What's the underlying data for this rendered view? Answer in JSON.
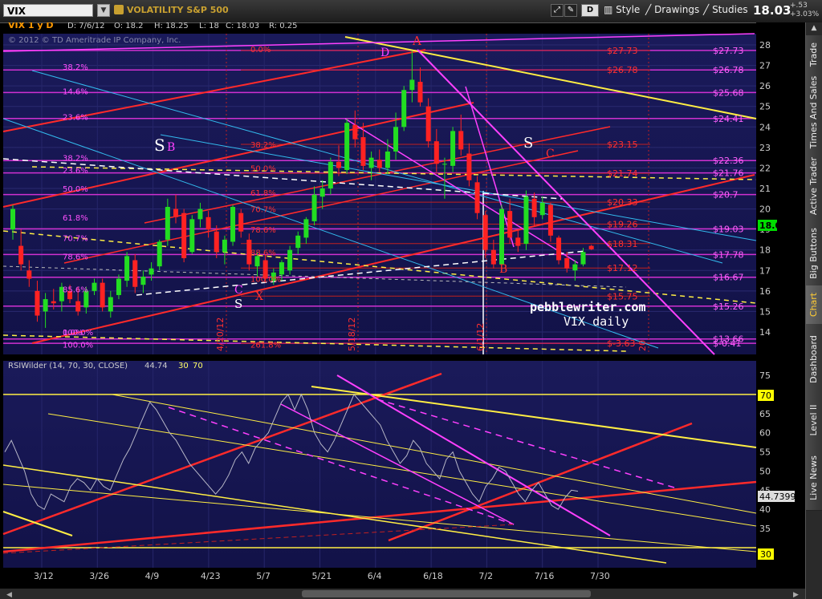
{
  "toolbar": {
    "symbol": "VIX",
    "symbol_name": "VOLATILITY S&P 500",
    "period_button": "D",
    "style_label": "Style",
    "drawings_label": "Drawings",
    "studies_label": "Studies",
    "last_price": "18.03",
    "net_change": "+.53",
    "pct_change": "+3.03%"
  },
  "sidebar": {
    "tabs": [
      {
        "label": "Trade",
        "active": false
      },
      {
        "label": "Times And Sales",
        "active": false
      },
      {
        "label": "Active Trader",
        "active": false
      },
      {
        "label": "Big Buttons",
        "active": false
      },
      {
        "label": "Chart",
        "active": true
      },
      {
        "label": "Dashboard",
        "active": false
      },
      {
        "label": "Level II",
        "active": false
      },
      {
        "label": "Live News",
        "active": false
      }
    ]
  },
  "price_chart": {
    "symbol_label": "VIX 1 y D",
    "ohlc": {
      "date": "D: 7/6/12",
      "open": "O: 18.2",
      "high": "H: 18.25",
      "low": "L: 18",
      "close": "C: 18.03",
      "range": "R: 0.25"
    },
    "copyright": "© 2012 © TD Ameritrade IP Company, Inc.",
    "watermark_1": "pebblewriter.com",
    "watermark_2": "VIX daily",
    "current_price_tag": "18.03",
    "price_axis_ticks": [
      "28",
      "27",
      "26",
      "25",
      "24",
      "23",
      "22",
      "21",
      "20",
      "19",
      "18",
      "17",
      "16",
      "15",
      "14"
    ],
    "right_level_labels": [
      {
        "text": "$27.73",
        "value": 27.73
      },
      {
        "text": "$26.78",
        "value": 26.78
      },
      {
        "text": "$25.68",
        "value": 25.68
      },
      {
        "text": "$24.41",
        "value": 24.41
      },
      {
        "text": "$22.36",
        "value": 22.36
      },
      {
        "text": "$21.76",
        "value": 21.76
      },
      {
        "text": "$20.7",
        "value": 20.7
      },
      {
        "text": "$19.03",
        "value": 19.03
      },
      {
        "text": "$17.78",
        "value": 17.78
      },
      {
        "text": "$16.67",
        "value": 16.67
      },
      {
        "text": "$15.26",
        "value": 15.26
      },
      {
        "text": "$13.66",
        "value": 13.66
      },
      {
        "text": "$-0.41",
        "value": 13.45
      }
    ],
    "mid_level_labels": [
      {
        "text": "$27.73",
        "value": 27.73
      },
      {
        "text": "$26.78",
        "value": 26.78
      },
      {
        "text": "$23.15",
        "value": 23.15
      },
      {
        "text": "$21.74",
        "value": 21.74
      },
      {
        "text": "$20.33",
        "value": 20.33
      },
      {
        "text": "$19.26",
        "value": 19.26
      },
      {
        "text": "$18.31",
        "value": 18.31
      },
      {
        "text": "$17.12",
        "value": 17.12
      },
      {
        "text": "$15.75",
        "value": 15.75
      },
      {
        "text": "$-3.63",
        "value": 13.45
      }
    ],
    "fib_left_labels": [
      {
        "text": "38.2%",
        "value": 26.95
      },
      {
        "text": "14.6%",
        "value": 25.75
      },
      {
        "text": "23.6%",
        "value": 24.5
      },
      {
        "text": "38.2%",
        "value": 22.5
      },
      {
        "text": "23.6%",
        "value": 21.9
      },
      {
        "text": "50.0%",
        "value": 21.0
      },
      {
        "text": "61.8%",
        "value": 19.6
      },
      {
        "text": "70.7%",
        "value": 18.6
      },
      {
        "text": "78.6%",
        "value": 17.7
      },
      {
        "text": "85.6%",
        "value": 16.1
      },
      {
        "text": "100.0%",
        "value": 14.0
      },
      {
        "text": "0.0%",
        "value": 14.0
      },
      {
        "text": "100.0%",
        "value": 13.4
      }
    ],
    "fib_mid_labels": [
      {
        "text": "0.0%",
        "value": 27.8
      },
      {
        "text": "38.2%",
        "value": 23.15
      },
      {
        "text": "50.0%",
        "value": 22.0
      },
      {
        "text": "61.8%",
        "value": 20.8
      },
      {
        "text": "70.7%",
        "value": 20.0
      },
      {
        "text": "78.6%",
        "value": 19.0
      },
      {
        "text": "88.6%",
        "value": 17.9
      },
      {
        "text": "100.0%",
        "value": 16.6
      },
      {
        "text": "261.8%",
        "value": 13.4
      }
    ],
    "date_markers": [
      "4/20/12",
      "5/18/12",
      "6/1/12",
      "20"
    ],
    "wave_labels": [
      {
        "text": "A",
        "color": "#ff3030"
      },
      {
        "text": "D",
        "color": "#ff40ff"
      },
      {
        "text": "S",
        "color": "#ffffff"
      },
      {
        "text": "B",
        "color": "#ff40ff"
      },
      {
        "text": "S",
        "color": "#ffffff"
      },
      {
        "text": "C",
        "color": "#ff3030"
      },
      {
        "text": "B",
        "color": "#ff3030"
      },
      {
        "text": "C",
        "color": "#ff40ff"
      },
      {
        "text": "S",
        "color": "#ffffff"
      },
      {
        "text": "X",
        "color": "#ff3030"
      }
    ]
  },
  "rsi_chart": {
    "label": "RSIWilder (14, 70, 30, CLOSE)",
    "value": "44.74",
    "param_1": "30",
    "param_2": "70",
    "axis_ticks": [
      "75",
      "70",
      "65",
      "60",
      "55",
      "50",
      "45",
      "40",
      "35",
      "30"
    ],
    "tag_70": "70",
    "tag_30": "30",
    "current_tag": "44.7399"
  },
  "x_axis": {
    "ticks": [
      "3/12",
      "3/26",
      "4/9",
      "4/23",
      "5/7",
      "5/21",
      "6/4",
      "6/18",
      "7/2",
      "7/16",
      "7/30"
    ]
  },
  "chart_data": [
    {
      "type": "candlestick",
      "title": "VIX 1 y D",
      "y_range": [
        13.3,
        28.5
      ],
      "candles": [
        [
          19.0,
          20.2,
          18.5,
          20.0
        ],
        [
          18.2,
          19.0,
          17.0,
          17.3
        ],
        [
          17.0,
          17.5,
          16.2,
          16.6
        ],
        [
          16.0,
          16.5,
          14.5,
          14.8
        ],
        [
          15.0,
          15.9,
          14.2,
          15.6
        ],
        [
          15.5,
          16.1,
          15.1,
          15.4
        ],
        [
          15.5,
          16.4,
          15.0,
          16.2
        ],
        [
          16.0,
          16.3,
          15.4,
          15.6
        ],
        [
          15.5,
          16.2,
          14.8,
          15.0
        ],
        [
          15.2,
          16.2,
          14.9,
          16.0
        ],
        [
          16.0,
          16.6,
          15.8,
          16.4
        ],
        [
          16.4,
          16.6,
          15.0,
          15.2
        ],
        [
          15.0,
          16.0,
          14.7,
          15.7
        ],
        [
          15.8,
          16.8,
          15.6,
          16.6
        ],
        [
          16.5,
          17.9,
          16.2,
          17.7
        ],
        [
          17.5,
          17.8,
          15.9,
          16.2
        ],
        [
          16.3,
          17.0,
          15.9,
          16.7
        ],
        [
          16.8,
          17.4,
          16.5,
          17.1
        ],
        [
          17.2,
          18.5,
          17.0,
          18.4
        ],
        [
          18.5,
          20.5,
          18.2,
          20.1
        ],
        [
          20.0,
          20.7,
          19.3,
          19.6
        ],
        [
          19.8,
          20.0,
          17.4,
          17.6
        ],
        [
          17.9,
          19.7,
          17.8,
          19.5
        ],
        [
          19.5,
          20.3,
          19.1,
          20.0
        ],
        [
          19.6,
          19.9,
          18.6,
          19.0
        ],
        [
          18.9,
          19.2,
          17.6,
          17.9
        ],
        [
          17.9,
          18.7,
          17.3,
          18.5
        ],
        [
          18.4,
          20.2,
          18.2,
          20.1
        ],
        [
          19.8,
          20.0,
          18.6,
          18.9
        ],
        [
          18.5,
          18.8,
          17.0,
          17.3
        ],
        [
          17.2,
          17.9,
          16.7,
          17.7
        ],
        [
          17.5,
          17.8,
          16.4,
          16.6
        ],
        [
          16.5,
          17.1,
          16.3,
          16.9
        ],
        [
          16.8,
          17.5,
          16.5,
          17.4
        ],
        [
          17.0,
          18.2,
          16.8,
          18.0
        ],
        [
          18.1,
          18.9,
          17.8,
          18.7
        ],
        [
          18.6,
          19.6,
          18.3,
          19.5
        ],
        [
          19.4,
          21.1,
          19.2,
          20.7
        ],
        [
          20.6,
          21.4,
          20.0,
          21.0
        ],
        [
          21.0,
          22.5,
          20.7,
          22.3
        ],
        [
          22.3,
          23.1,
          21.6,
          22.0
        ],
        [
          21.9,
          24.4,
          21.7,
          24.2
        ],
        [
          24.1,
          24.8,
          23.0,
          23.4
        ],
        [
          23.5,
          24.2,
          21.9,
          22.1
        ],
        [
          22.0,
          22.8,
          21.4,
          22.5
        ],
        [
          22.4,
          22.9,
          21.8,
          22.0
        ],
        [
          22.0,
          23.4,
          21.7,
          22.8
        ],
        [
          22.8,
          24.7,
          22.4,
          24.0
        ],
        [
          24.0,
          26.0,
          23.8,
          25.8
        ],
        [
          25.8,
          27.7,
          25.2,
          26.3
        ],
        [
          26.2,
          26.9,
          25.0,
          25.2
        ],
        [
          25.0,
          25.4,
          23.0,
          23.3
        ],
        [
          23.3,
          23.9,
          21.8,
          22.2
        ],
        [
          22.2,
          22.5,
          20.5,
          22.2
        ],
        [
          22.1,
          24.0,
          21.8,
          23.8
        ],
        [
          23.8,
          24.6,
          22.6,
          22.9
        ],
        [
          22.7,
          23.2,
          21.1,
          21.4
        ],
        [
          21.3,
          21.6,
          19.5,
          19.8
        ],
        [
          19.7,
          19.9,
          17.6,
          18.0
        ],
        [
          18.0,
          18.5,
          17.1,
          17.3
        ],
        [
          17.3,
          20.2,
          17.0,
          20.0
        ],
        [
          19.9,
          20.5,
          18.3,
          18.6
        ],
        [
          18.6,
          19.0,
          17.9,
          18.2
        ],
        [
          18.3,
          20.9,
          18.0,
          20.6
        ],
        [
          20.5,
          20.8,
          19.2,
          19.6
        ],
        [
          19.7,
          20.6,
          19.5,
          20.3
        ],
        [
          20.2,
          20.3,
          18.4,
          18.7
        ],
        [
          18.6,
          18.7,
          17.3,
          17.5
        ],
        [
          17.6,
          17.9,
          16.9,
          17.1
        ],
        [
          17.0,
          17.5,
          16.5,
          17.3
        ],
        [
          17.3,
          18.1,
          17.2,
          17.9
        ],
        [
          18.2,
          18.25,
          18.0,
          18.03
        ]
      ]
    },
    {
      "type": "line",
      "title": "RSIWilder (14, 70, 30, CLOSE)",
      "y_range": [
        27,
        76
      ],
      "values": [
        55,
        58,
        54,
        50,
        44,
        41,
        40,
        44,
        43,
        42,
        46,
        48,
        47,
        45,
        48,
        46,
        45,
        49,
        53,
        56,
        60,
        64,
        68,
        66,
        63,
        60,
        58,
        55,
        52,
        50,
        48,
        46,
        44,
        46,
        49,
        53,
        55,
        52,
        56,
        58,
        60,
        64,
        68,
        70,
        66,
        70,
        66,
        60,
        57,
        55,
        58,
        62,
        66,
        70,
        68,
        66,
        64,
        62,
        58,
        55,
        52,
        54,
        58,
        56,
        52,
        50,
        48,
        53,
        55,
        50,
        47,
        44,
        42,
        46,
        48,
        51,
        50,
        47,
        44,
        42,
        45,
        47,
        44,
        41,
        40,
        43,
        45,
        44.74
      ]
    }
  ]
}
